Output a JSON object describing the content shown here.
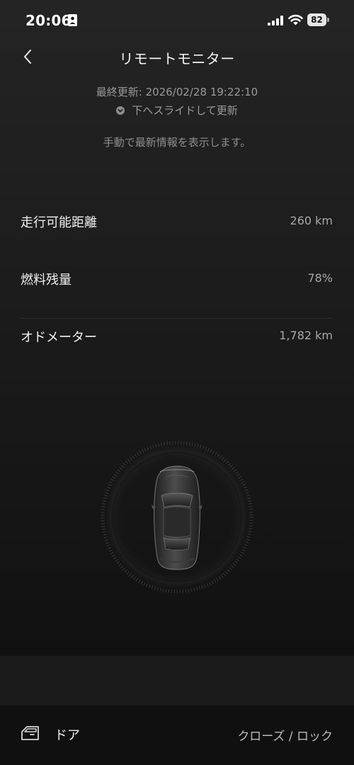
{
  "status_bar": {
    "time": "20:06",
    "battery_level": "82"
  },
  "header": {
    "title": "リモートモニター",
    "back_icon": "chevron-left-icon"
  },
  "update_info": {
    "last_updated": "最終更新: 2026/02/28 19:22:10",
    "slide_hint": "下へスライドして更新",
    "manual_hint": "手動で最新情報を表示します。"
  },
  "metrics": [
    {
      "label": "走行可能距離",
      "value": "260 km"
    },
    {
      "label": "燃料残量",
      "value": "78%"
    },
    {
      "label": "オドメーター",
      "value": "1,782 km"
    }
  ],
  "bottom_bar": {
    "icon": "car-door-icon",
    "label": "ドア",
    "status": "クローズ / ロック"
  },
  "colors": {
    "background": "#1b1b1b",
    "primary_text": "#f0f0f0",
    "secondary_text": "#9a9a9a"
  }
}
